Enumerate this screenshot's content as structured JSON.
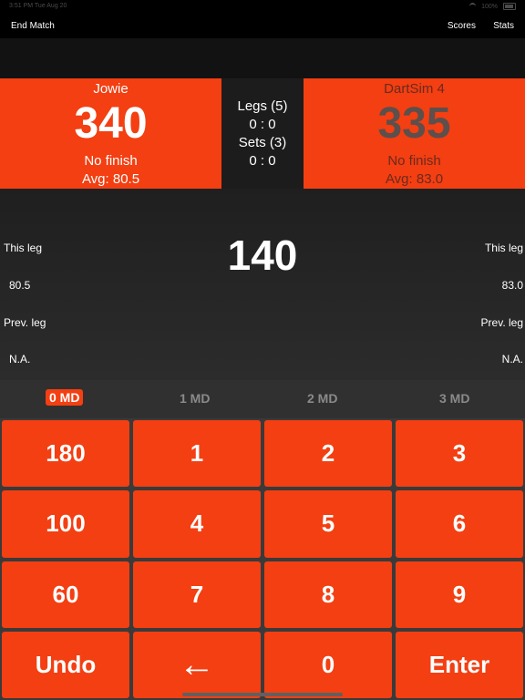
{
  "status_bar": {
    "time": "3:51 PM",
    "date": "Tue Aug 20",
    "battery": "100%"
  },
  "nav": {
    "end_match": "End Match",
    "scores": "Scores",
    "stats": "Stats"
  },
  "player1": {
    "name": "Jowie",
    "score": "340",
    "finish": "No finish",
    "avg": "Avg: 80.5"
  },
  "player2": {
    "name": "DartSim 4",
    "score": "335",
    "finish": "No finish",
    "avg": "Avg: 83.0"
  },
  "match": {
    "legs_label": "Legs (5)",
    "legs_score": "0 : 0",
    "sets_label": "Sets (3)",
    "sets_score": "0 : 0"
  },
  "current_input": "140",
  "left_stats": {
    "this_leg_label": "This leg",
    "this_leg_value": "80.5",
    "prev_leg_label": "Prev. leg",
    "prev_leg_value": "N.A."
  },
  "right_stats": {
    "this_leg_label": "This leg",
    "this_leg_value": "83.0",
    "prev_leg_label": "Prev. leg",
    "prev_leg_value": "N.A."
  },
  "md_options": [
    "0 MD",
    "1 MD",
    "2 MD",
    "3 MD"
  ],
  "keys": [
    "180",
    "1",
    "2",
    "3",
    "100",
    "4",
    "5",
    "6",
    "60",
    "7",
    "8",
    "9",
    "Undo",
    "←",
    "0",
    "Enter"
  ],
  "colors": {
    "accent": "#f33f12",
    "background": "#1c1c1c"
  }
}
